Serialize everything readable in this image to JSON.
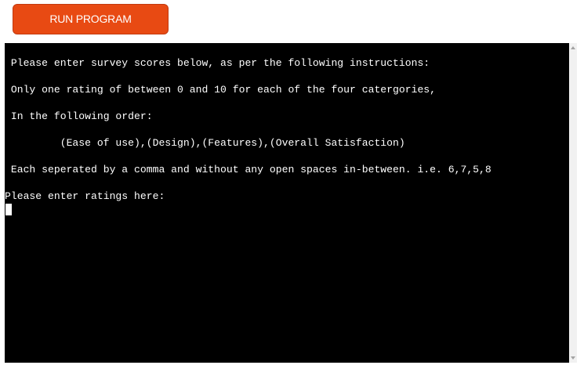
{
  "toolbar": {
    "run_label": "RUN PROGRAM"
  },
  "terminal": {
    "lines": [
      " Please enter survey scores below, as per the following instructions:",
      " Only one rating of between 0 and 10 for each of the four catergories,",
      " In the following order:",
      "         (Ease of use),(Design),(Features),(Overall Satisfaction)",
      " Each seperated by a comma and without any open spaces in-between. i.e. 6,7,5,8",
      "Please enter ratings here:"
    ],
    "input_value": ""
  },
  "colors": {
    "run_button": "#e84a13",
    "terminal_bg": "#000000",
    "terminal_fg": "#ffffff"
  }
}
